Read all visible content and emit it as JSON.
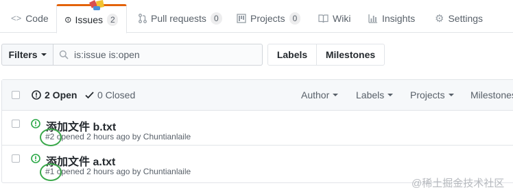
{
  "tabs": [
    {
      "label": "Code",
      "icon": "code-icon"
    },
    {
      "label": "Issues",
      "count": "2",
      "icon": "issue-opened-icon",
      "selected": true
    },
    {
      "label": "Pull requests",
      "count": "0",
      "icon": "git-pull-request-icon"
    },
    {
      "label": "Projects",
      "count": "0",
      "icon": "project-icon"
    },
    {
      "label": "Wiki",
      "icon": "book-icon"
    },
    {
      "label": "Insights",
      "icon": "graph-icon"
    },
    {
      "label": "Settings",
      "icon": "gear-icon"
    }
  ],
  "filters": {
    "filters_label": "Filters",
    "search_value": "is:issue is:open",
    "labels_label": "Labels",
    "milestones_label": "Milestones"
  },
  "issues_header": {
    "open_label": "2 Open",
    "closed_label": "0 Closed",
    "author_label": "Author",
    "labels_label": "Labels",
    "projects_label": "Projects",
    "milestones_label": "Milestones"
  },
  "issues": [
    {
      "title": "添加文件 b.txt",
      "number": "#2",
      "meta": "opened 2 hours ago by Chuntianlaile"
    },
    {
      "title": "添加文件 a.txt",
      "number": "#1",
      "meta": "opened 2 hours ago by Chuntianlaile"
    }
  ],
  "watermark": "@稀土掘金技术社区",
  "colors": {
    "accent_tab": "#e36209",
    "open_green": "#28a745",
    "annotation_green": "#3aa84a"
  }
}
